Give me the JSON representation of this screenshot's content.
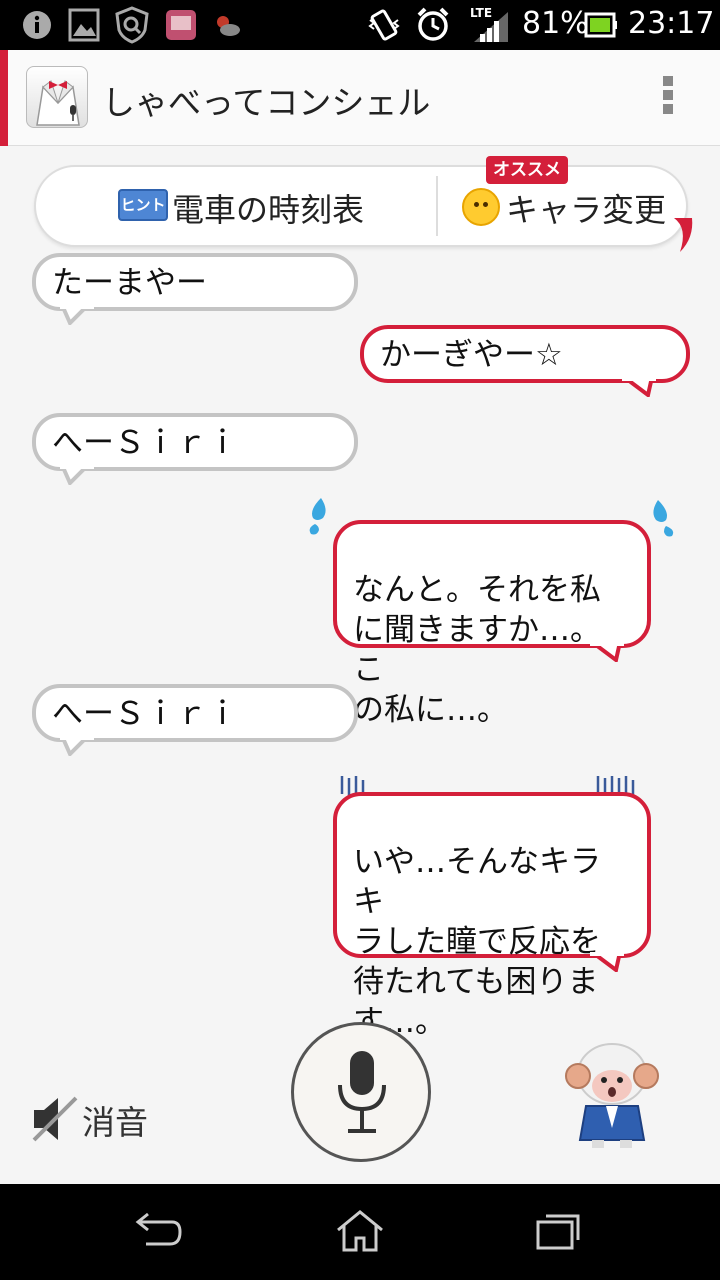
{
  "status_bar": {
    "battery_percent": "81%",
    "time": "23:17",
    "network": "LTE",
    "icons": [
      "info-icon",
      "image-icon",
      "shield-icon",
      "app-icon",
      "weather-icon",
      "vibrate-icon",
      "alarm-icon",
      "signal-icon",
      "battery-icon"
    ]
  },
  "app_bar": {
    "title": "しゃべってコンシェル",
    "accent_color": "#d41f3a"
  },
  "hint_bar": {
    "hint_badge": "ヒント",
    "hint_text": "電車の時刻表",
    "recommend_badge": "オススメ",
    "character_change": "キャラ変更"
  },
  "conversation": [
    {
      "side": "user",
      "text": "たーまやー"
    },
    {
      "side": "concierge",
      "text": "かーぎやー☆"
    },
    {
      "side": "user",
      "text": "へーＳｉｒｉ"
    },
    {
      "side": "concierge",
      "text": "なんと。それを私\nに聞きますか…。こ\nの私に…。"
    },
    {
      "side": "user",
      "text": "へーＳｉｒｉ"
    },
    {
      "side": "concierge",
      "text": "いや…そんなキラキ\nラした瞳で反応を\n待たれても困りま\nす…。"
    }
  ],
  "controls": {
    "mute_label": "消音",
    "mic_icon": "microphone-icon",
    "character_icon": "sheep-character-icon"
  },
  "nav_bar": {
    "icons": [
      "back-icon",
      "home-icon",
      "recent-apps-icon"
    ]
  },
  "colors": {
    "concierge_border": "#d41f3a",
    "user_border": "#c4c4c4",
    "hint_badge": "#4e86d4"
  }
}
